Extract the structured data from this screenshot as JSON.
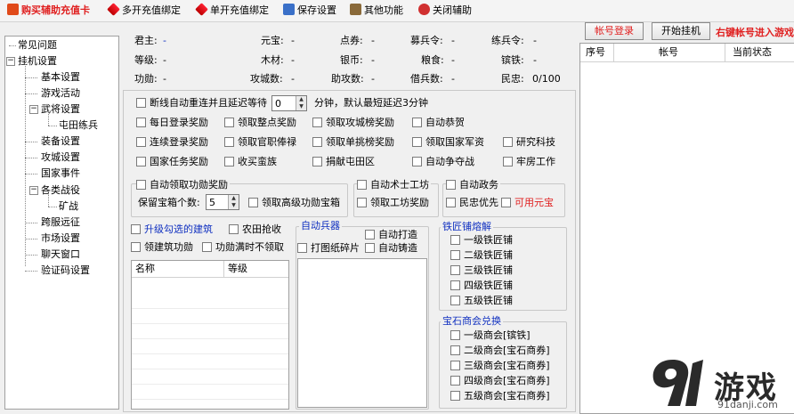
{
  "toolbar": {
    "buy": "购买辅助充值卡",
    "multi_bind": "多开充值绑定",
    "single_bind": "单开充值绑定",
    "save": "保存设置",
    "other": "其他功能",
    "close": "关闭辅助"
  },
  "tree": {
    "faq": "常见问题",
    "hang": "挂机设置",
    "basic": "基本设置",
    "activity": "游戏活动",
    "general": "武将设置",
    "farm": "屯田练兵",
    "equip": "装备设置",
    "siege": "攻城设置",
    "nation": "国家事件",
    "battle": "各类战役",
    "mine": "矿战",
    "cross": "跨服远征",
    "market": "市场设置",
    "chat": "聊天窗口",
    "captcha": "验证码设置"
  },
  "info": {
    "lord_label": "君主:",
    "lord_val": "-",
    "yuanbao_label": "元宝:",
    "yuanbao_val": "-",
    "points_label": "点券:",
    "points_val": "-",
    "recruit_label": "募兵令:",
    "recruit_val": "-",
    "train_label": "练兵令:",
    "train_val": "-",
    "level_label": "等级:",
    "level_val": "-",
    "wood_label": "木材:",
    "wood_val": "-",
    "silver_label": "银币:",
    "silver_val": "-",
    "food_label": "粮食:",
    "food_val": "-",
    "iron_label": "镔铁:",
    "iron_val": "-",
    "merit_label": "功勋:",
    "merit_val": "-",
    "siegecount_label": "攻城数:",
    "siegecount_val": "-",
    "assist_label": "助攻数:",
    "assist_val": "-",
    "borrow_label": "借兵数:",
    "borrow_val": "-",
    "morale_label": "民忠:",
    "morale_val": "0/100"
  },
  "main": {
    "reconnect": "断线自动重连并且延迟等待",
    "reconnect_val": "0",
    "reconnect_suffix": "分钟，默认最短延迟3分钟",
    "row1": [
      "每日登录奖励",
      "领取整点奖励",
      "领取攻城榜奖励",
      "自动恭贺"
    ],
    "row2": [
      "连续登录奖励",
      "领取官职俸禄",
      "领取单挑榜奖励",
      "领取国家军资",
      "研究科技"
    ],
    "row3": [
      "国家任务奖励",
      "收买蛮族",
      "捐献屯田区",
      "自动争夺战",
      "牢房工作"
    ],
    "merit_group": "自动领取功勋奖励",
    "keep_box": "保留宝箱个数:",
    "keep_box_val": "5",
    "high_box": "领取高级功勋宝箱",
    "workshop_group": "自动术士工坊",
    "workshop_reward": "领取工坊奖励",
    "politics_group": "自动政务",
    "people_first": "民忠优先",
    "use_yuanbao": "可用元宝",
    "upgrade_building": "升级勾选的建筑",
    "farm_grab": "农田抢收",
    "build_merit": "领建筑功勋",
    "merit_full": "功勋满时不领取",
    "col_name": "名称",
    "col_level": "等级",
    "weapon_group": "自动兵器",
    "auto_forge": "自动打造",
    "fragments": "打图纸碎片",
    "auto_cast": "自动铸造",
    "smelt_group": "铁匠铺熔解",
    "smelt": [
      "一级铁匠铺",
      "二级铁匠铺",
      "三级铁匠铺",
      "四级铁匠铺",
      "五级铁匠铺"
    ],
    "gem_group": "宝石商会兑换",
    "gem": [
      "一级商会[镔铁]",
      "二级商会[宝石商券]",
      "三级商会[宝石商券]",
      "四级商会[宝石商券]",
      "五级商会[宝石商券]"
    ]
  },
  "right": {
    "login": "帐号登录",
    "start": "开始挂机",
    "hint": "右键帐号进入游戏",
    "col_no": "序号",
    "col_account": "帐号",
    "col_status": "当前状态"
  },
  "watermark": {
    "brand": "游戏",
    "url": "91danji.com"
  }
}
